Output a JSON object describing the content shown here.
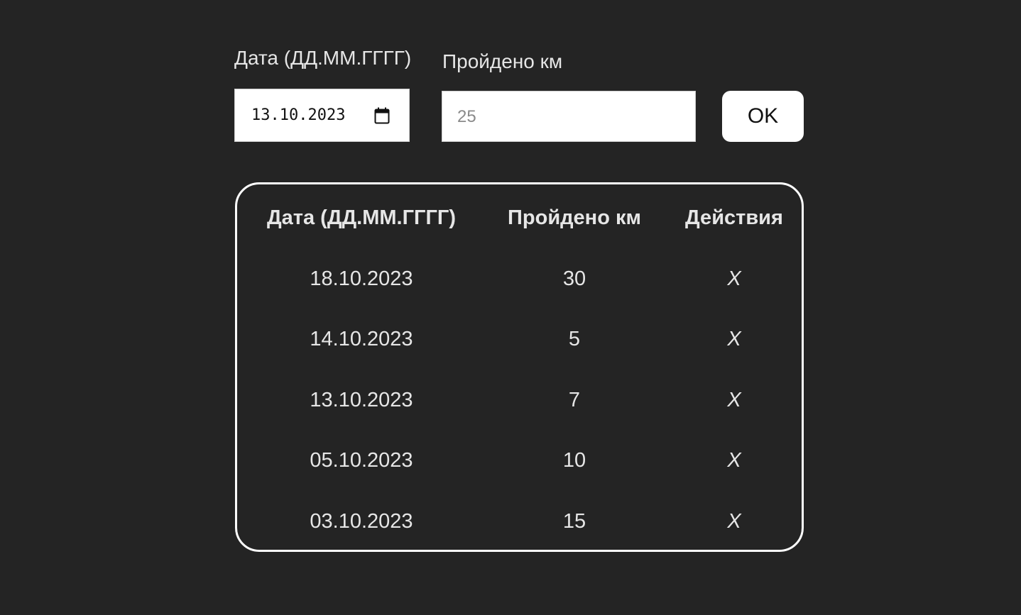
{
  "form": {
    "date_label": "Дата (ДД.ММ.ГГГГ)",
    "km_label": "Пройдено км",
    "date_value": "13.10.2023",
    "km_placeholder": "25",
    "ok_label": "OK"
  },
  "table": {
    "headers": [
      "Дата (ДД.ММ.ГГГГ)",
      "Пройдено км",
      "Действия"
    ],
    "rows": [
      {
        "date": "18.10.2023",
        "km": "30",
        "action": "X"
      },
      {
        "date": "14.10.2023",
        "km": "5",
        "action": "X"
      },
      {
        "date": "13.10.2023",
        "km": "7",
        "action": "X"
      },
      {
        "date": "05.10.2023",
        "km": "10",
        "action": "X"
      },
      {
        "date": "03.10.2023",
        "km": "15",
        "action": "X"
      }
    ]
  },
  "icons": {
    "date_picker": "calendar-icon"
  },
  "colors": {
    "background": "#242424",
    "text": "#e6e6e6",
    "input_bg": "#ffffff",
    "border": "#ffffff"
  }
}
